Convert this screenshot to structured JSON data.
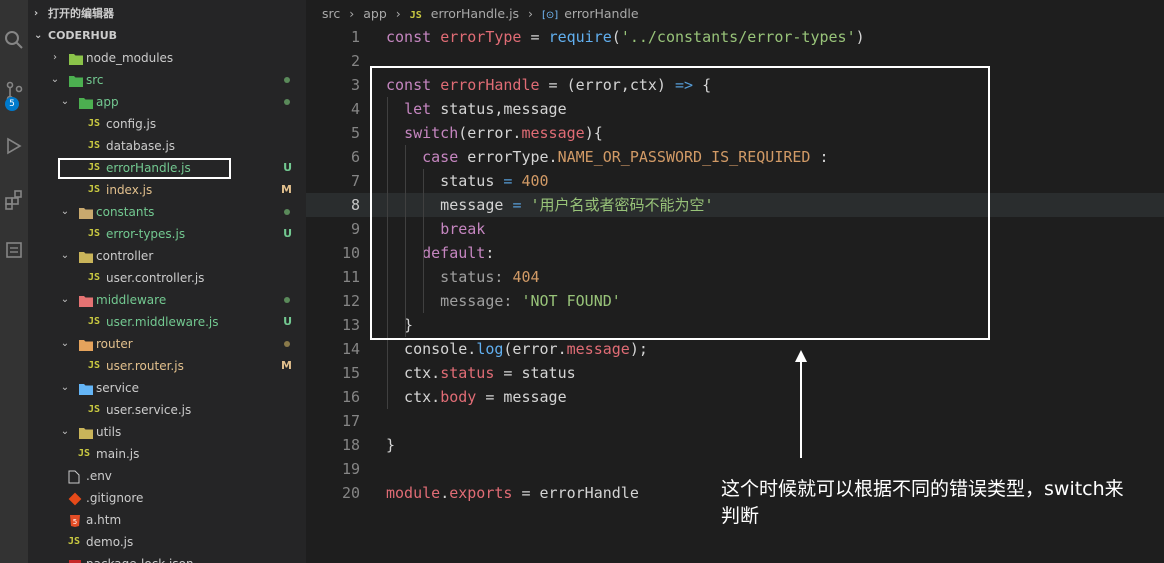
{
  "activity_bar": {
    "scm_badge": "5"
  },
  "sidebar": {
    "open_editors_label": "打开的编辑器",
    "project_label": "CODERHUB",
    "items": [
      {
        "name": "node_modules",
        "depth": 1,
        "kind": "folder",
        "twisty": "›",
        "icon_color": "#8bc34a",
        "text_color": "#cccccc",
        "status": "",
        "dot": ""
      },
      {
        "name": "src",
        "depth": 1,
        "kind": "folder",
        "twisty": "⌄",
        "icon_color": "#4caf50",
        "text_color": "#73c991",
        "status": "",
        "dot": "#5a8a5a"
      },
      {
        "name": "app",
        "depth": 2,
        "kind": "folder",
        "twisty": "⌄",
        "icon_color": "#4caf50",
        "text_color": "#73c991",
        "status": "",
        "dot": "#5a8a5a"
      },
      {
        "name": "config.js",
        "depth": 3,
        "kind": "js",
        "twisty": "",
        "text_color": "#cccccc",
        "status": "",
        "dot": ""
      },
      {
        "name": "database.js",
        "depth": 3,
        "kind": "js",
        "twisty": "",
        "text_color": "#cccccc",
        "status": "",
        "dot": ""
      },
      {
        "name": "errorHandle.js",
        "depth": 3,
        "kind": "js",
        "twisty": "",
        "text_color": "#73c991",
        "status": "U",
        "status_color": "#73c991",
        "dot": ""
      },
      {
        "name": "index.js",
        "depth": 3,
        "kind": "js",
        "twisty": "",
        "text_color": "#e2c08d",
        "status": "M",
        "status_color": "#e2c08d",
        "dot": ""
      },
      {
        "name": "constants",
        "depth": 2,
        "kind": "folder",
        "twisty": "⌄",
        "icon_color": "#c9a96e",
        "text_color": "#73c991",
        "status": "",
        "dot": "#5a8a5a"
      },
      {
        "name": "error-types.js",
        "depth": 3,
        "kind": "js",
        "twisty": "",
        "text_color": "#73c991",
        "status": "U",
        "status_color": "#73c991",
        "dot": ""
      },
      {
        "name": "controller",
        "depth": 2,
        "kind": "folder",
        "twisty": "⌄",
        "icon_color": "#c9b45a",
        "text_color": "#cccccc",
        "status": "",
        "dot": ""
      },
      {
        "name": "user.controller.js",
        "depth": 3,
        "kind": "js",
        "twisty": "",
        "text_color": "#cccccc",
        "status": "",
        "dot": ""
      },
      {
        "name": "middleware",
        "depth": 2,
        "kind": "folder",
        "twisty": "⌄",
        "icon_color": "#e57373",
        "text_color": "#73c991",
        "status": "",
        "dot": "#5a8a5a"
      },
      {
        "name": "user.middleware.js",
        "depth": 3,
        "kind": "js",
        "twisty": "",
        "text_color": "#73c991",
        "status": "U",
        "status_color": "#73c991",
        "dot": ""
      },
      {
        "name": "router",
        "depth": 2,
        "kind": "folder",
        "twisty": "⌄",
        "icon_color": "#e5a35c",
        "text_color": "#e2c08d",
        "status": "",
        "dot": "#8a7a4a"
      },
      {
        "name": "user.router.js",
        "depth": 3,
        "kind": "js",
        "twisty": "",
        "text_color": "#e2c08d",
        "status": "M",
        "status_color": "#e2c08d",
        "dot": ""
      },
      {
        "name": "service",
        "depth": 2,
        "kind": "folder",
        "twisty": "⌄",
        "icon_color": "#64b5f6",
        "text_color": "#cccccc",
        "status": "",
        "dot": ""
      },
      {
        "name": "user.service.js",
        "depth": 3,
        "kind": "js",
        "twisty": "",
        "text_color": "#cccccc",
        "status": "",
        "dot": ""
      },
      {
        "name": "utils",
        "depth": 2,
        "kind": "folder",
        "twisty": "⌄",
        "icon_color": "#c9b45a",
        "text_color": "#cccccc",
        "status": "",
        "dot": ""
      },
      {
        "name": "main.js",
        "depth": 2,
        "kind": "js",
        "twisty": "",
        "text_color": "#cccccc",
        "status": "",
        "dot": ""
      },
      {
        "name": ".env",
        "depth": 1,
        "kind": "file",
        "twisty": "",
        "text_color": "#cccccc",
        "status": "",
        "dot": ""
      },
      {
        "name": ".gitignore",
        "depth": 1,
        "kind": "git",
        "twisty": "",
        "text_color": "#cccccc",
        "status": "",
        "dot": ""
      },
      {
        "name": "a.htm",
        "depth": 1,
        "kind": "html",
        "twisty": "",
        "text_color": "#cccccc",
        "status": "",
        "dot": ""
      },
      {
        "name": "demo.js",
        "depth": 1,
        "kind": "js",
        "twisty": "",
        "text_color": "#cccccc",
        "status": "",
        "dot": ""
      },
      {
        "name": "package-lock.json",
        "depth": 1,
        "kind": "json",
        "twisty": "",
        "text_color": "#cccccc",
        "status": "",
        "dot": ""
      }
    ]
  },
  "breadcrumb": {
    "src": "src",
    "sep1": "›",
    "app": "app",
    "sep2": "›",
    "js_badge": "JS",
    "file": "errorHandle.js",
    "sep3": "›",
    "symbol_icon": "[⊙]",
    "symbol": "errorHandle"
  },
  "editor": {
    "active_line": 8,
    "lines": [
      [
        [
          "kw",
          "const "
        ],
        [
          "var",
          "errorType"
        ],
        [
          "pl",
          " = "
        ],
        [
          "fn",
          "require"
        ],
        [
          "pl",
          "("
        ],
        [
          "str",
          "'../constants/error-types'"
        ],
        [
          "pl",
          ")"
        ]
      ],
      [],
      [
        [
          "kw",
          "const "
        ],
        [
          "var",
          "errorHandle"
        ],
        [
          "pl",
          " = (error,ctx) "
        ],
        [
          "dec",
          "=>"
        ],
        [
          "pl",
          " {"
        ]
      ],
      [
        [
          "pl",
          "  "
        ],
        [
          "kw",
          "let "
        ],
        [
          "pl",
          "status,message"
        ]
      ],
      [
        [
          "pl",
          "  "
        ],
        [
          "kw",
          "switch"
        ],
        [
          "pl",
          "(error."
        ],
        [
          "var",
          "message"
        ],
        [
          "pl",
          "){"
        ]
      ],
      [
        [
          "pl",
          "    "
        ],
        [
          "kw",
          "case "
        ],
        [
          "pl",
          "errorType."
        ],
        [
          "prop",
          "NAME_OR_PASSWORD_IS_REQUIRED"
        ],
        [
          "pl",
          " :"
        ]
      ],
      [
        [
          "pl",
          "      status "
        ],
        [
          "dec",
          "="
        ],
        [
          "num",
          " 400"
        ]
      ],
      [
        [
          "pl",
          "      message "
        ],
        [
          "dec",
          "="
        ],
        [
          "str",
          " '用户名或者密码不能为空'"
        ]
      ],
      [
        [
          "pl",
          "      "
        ],
        [
          "kw",
          "break"
        ]
      ],
      [
        [
          "pl",
          "    "
        ],
        [
          "kw",
          "default"
        ],
        [
          "pl",
          ":"
        ]
      ],
      [
        [
          "dim",
          "      status: "
        ],
        [
          "num",
          "404"
        ]
      ],
      [
        [
          "dim",
          "      message: "
        ],
        [
          "str",
          "'NOT FOUND'"
        ]
      ],
      [
        [
          "pl",
          "  }"
        ]
      ],
      [
        [
          "pl",
          "  console."
        ],
        [
          "fn",
          "log"
        ],
        [
          "pl",
          "(error."
        ],
        [
          "var",
          "message"
        ],
        [
          "pl",
          ");"
        ]
      ],
      [
        [
          "pl",
          "  ctx."
        ],
        [
          "var",
          "status"
        ],
        [
          "pl",
          " = status"
        ]
      ],
      [
        [
          "pl",
          "  ctx."
        ],
        [
          "var",
          "body"
        ],
        [
          "pl",
          " = message"
        ]
      ],
      [],
      [
        [
          "pl",
          "}"
        ]
      ],
      [],
      [
        [
          "var",
          "module"
        ],
        [
          "pl",
          "."
        ],
        [
          "var",
          "exports"
        ],
        [
          "pl",
          " = errorHandle"
        ]
      ]
    ]
  },
  "annotation": {
    "text": "这个时候就可以根据不同的错误类型，switch来判断"
  }
}
